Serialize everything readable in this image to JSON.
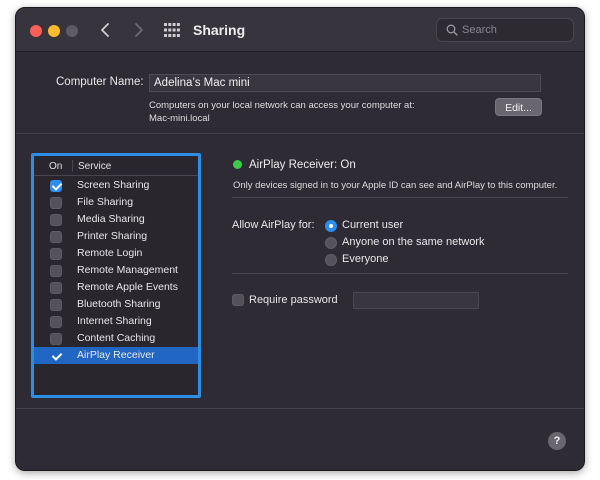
{
  "window": {
    "title": "Sharing",
    "search": {
      "placeholder": "Search",
      "value": ""
    }
  },
  "computer_name": {
    "label": "Computer Name:",
    "value": "Adelina’s Mac mini",
    "note_line1": "Computers on your local network can access your computer at:",
    "note_line2": "Mac-mini.local",
    "edit_label": "Edit..."
  },
  "services": {
    "header_on": "On",
    "header_service": "Service",
    "items": [
      {
        "label": "Screen Sharing",
        "on": true,
        "selected": false
      },
      {
        "label": "File Sharing",
        "on": false,
        "selected": false
      },
      {
        "label": "Media Sharing",
        "on": false,
        "selected": false
      },
      {
        "label": "Printer Sharing",
        "on": false,
        "selected": false
      },
      {
        "label": "Remote Login",
        "on": false,
        "selected": false
      },
      {
        "label": "Remote Management",
        "on": false,
        "selected": false
      },
      {
        "label": "Remote Apple Events",
        "on": false,
        "selected": false
      },
      {
        "label": "Bluetooth Sharing",
        "on": false,
        "selected": false
      },
      {
        "label": "Internet Sharing",
        "on": false,
        "selected": false
      },
      {
        "label": "Content Caching",
        "on": false,
        "selected": false
      },
      {
        "label": "AirPlay Receiver",
        "on": true,
        "selected": true
      }
    ]
  },
  "detail": {
    "status_title": "AirPlay Receiver: On",
    "status_color": "#3ccb4a",
    "status_desc": "Only devices signed in to your Apple ID can see and AirPlay to this computer.",
    "allow_label": "Allow AirPlay for:",
    "options": [
      {
        "label": "Current user",
        "selected": true
      },
      {
        "label": "Anyone on the same network",
        "selected": false
      },
      {
        "label": "Everyone",
        "selected": false
      }
    ],
    "require_password_label": "Require password",
    "require_password_checked": false,
    "password_value": ""
  },
  "help": {
    "label": "?"
  },
  "colors": {
    "accent": "#2d8ef0",
    "selection": "#2266c4",
    "window_bg": "#2f2b35"
  }
}
